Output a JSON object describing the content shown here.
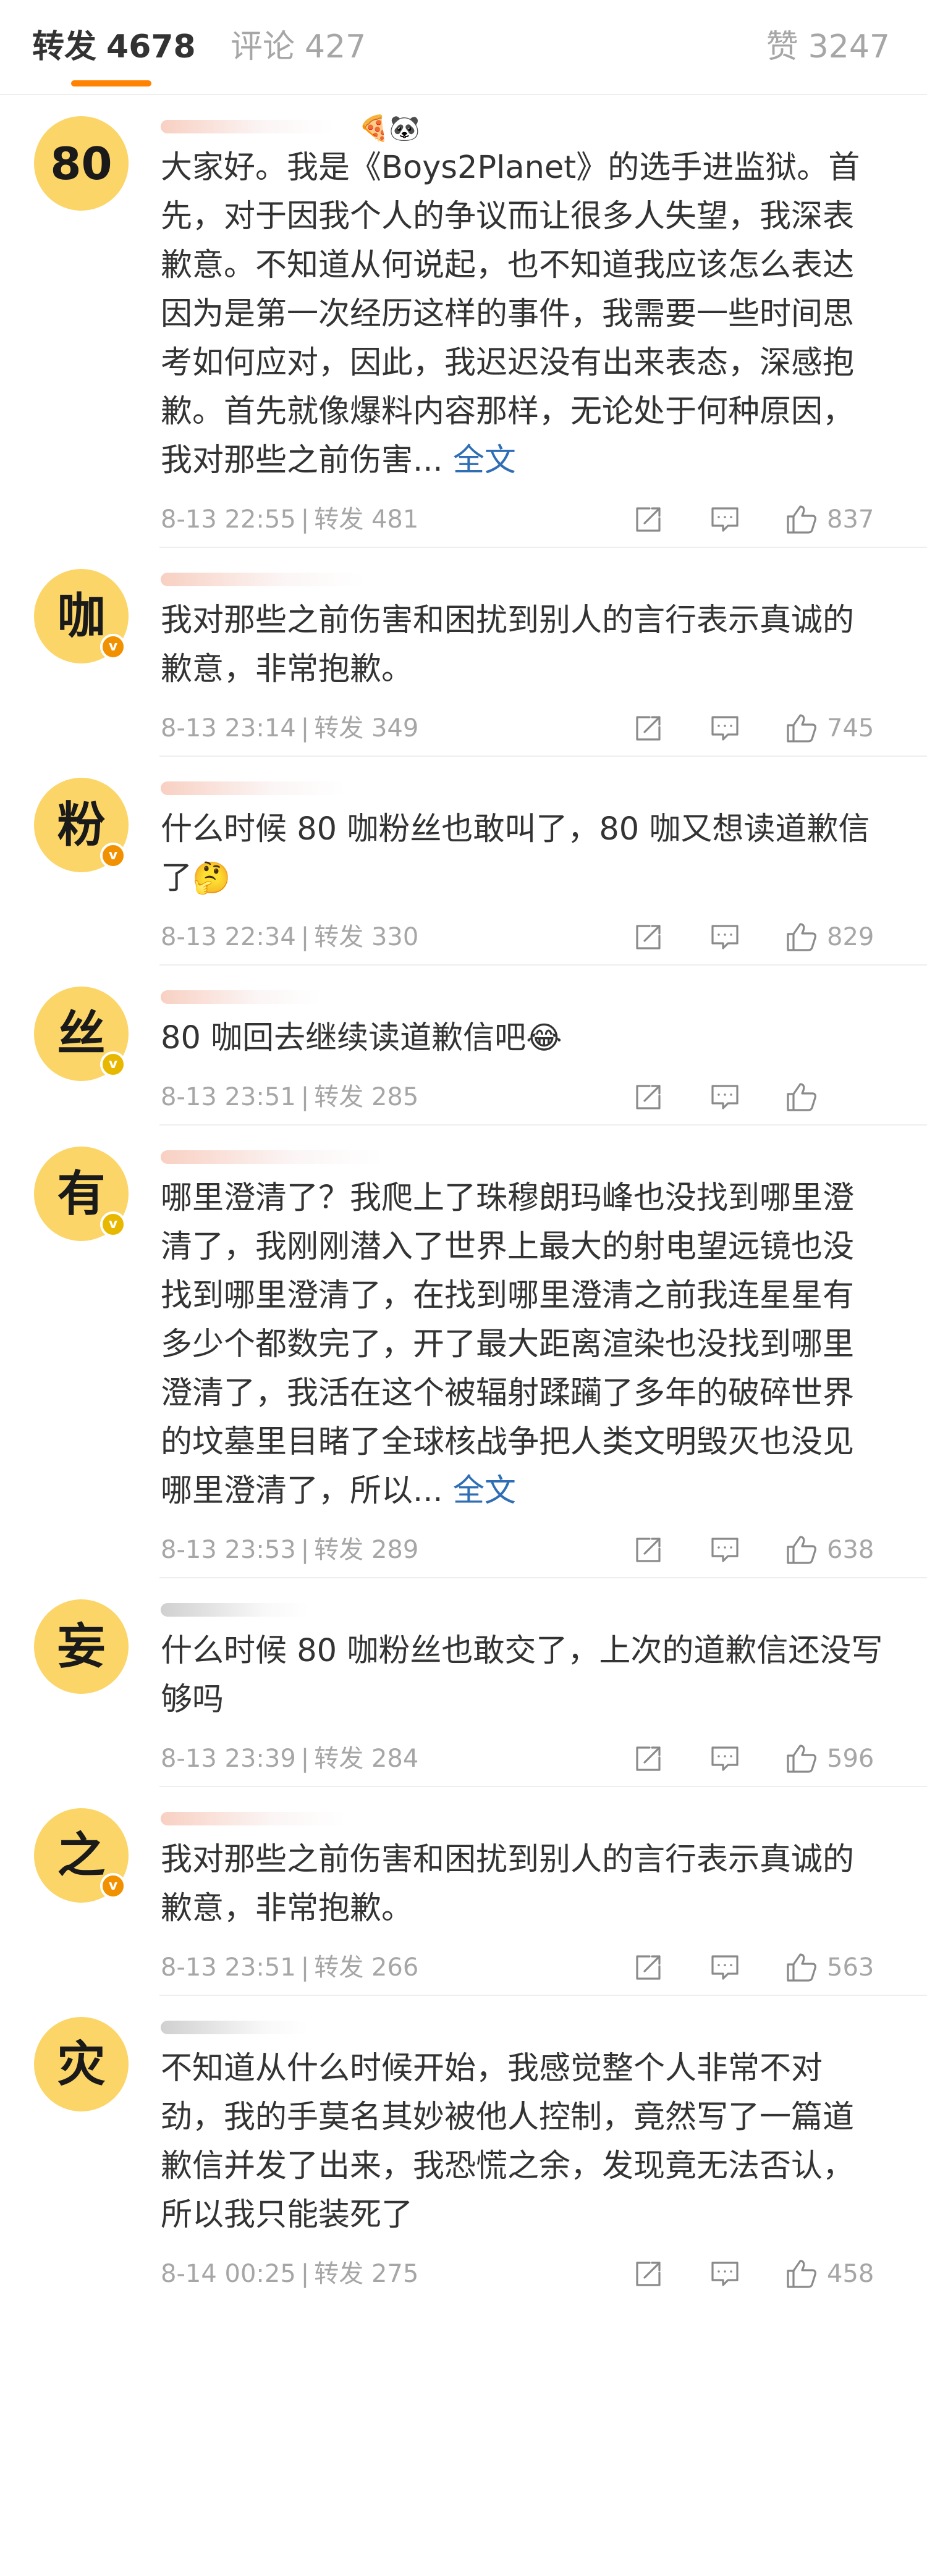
{
  "tabs": {
    "repost_label": "转发",
    "repost_count": "4678",
    "comment_label": "评论",
    "comment_count": "427",
    "like_label": "赞",
    "like_count": "3247"
  },
  "accent_color": "#ff8200",
  "avatar_color": "#fbd567",
  "link_color": "#2f6eb5",
  "posts": [
    {
      "avatar_char": "80",
      "badge": "",
      "username_icons": "🍕🐼",
      "text": "大家好。我是《Boys2Planet》的选手进监狱。首先，对于因我个人的争议而让很多人失望，我深表歉意。不知道从何说起，也不知道我应该怎么表达因为是第一次经历这样的事件，我需要一些时间思考如何应对，因此，我迟迟没有出来表态，深感抱歉。首先就像爆料内容那样，无论处于何种原因，我对那些之前伤害... ",
      "full_text": "全文",
      "emoji": "",
      "time": "8-13 22:55",
      "repost_label": "转发",
      "reposts": "481",
      "likes": "837"
    },
    {
      "avatar_char": "咖",
      "badge": "orange",
      "username_icons": "",
      "text": "我对那些之前伤害和困扰到别人的言行表示真诚的歉意，非常抱歉。",
      "full_text": "",
      "emoji": "",
      "time": "8-13 23:14",
      "repost_label": "转发",
      "reposts": "349",
      "likes": "745"
    },
    {
      "avatar_char": "粉",
      "badge": "orange",
      "username_icons": "",
      "text": "什么时候 80 咖粉丝也敢叫了，80 咖又想读道歉信了",
      "full_text": "",
      "emoji": "🤔",
      "time": "8-13 22:34",
      "repost_label": "转发",
      "reposts": "330",
      "likes": "829"
    },
    {
      "avatar_char": "丝",
      "badge": "yellow",
      "username_icons": "",
      "text": "80 咖回去继续读道歉信吧",
      "full_text": "",
      "emoji": "😂",
      "time": "8-13 23:51",
      "repost_label": "转发",
      "reposts": "285",
      "likes": ""
    },
    {
      "avatar_char": "有",
      "badge": "yellow",
      "username_icons": "",
      "text": "哪里澄清了？我爬上了珠穆朗玛峰也没找到哪里澄清了，我刚刚潜入了世界上最大的射电望远镜也没找到哪里澄清了，在找到哪里澄清之前我连星星有多少个都数完了，开了最大距离渲染也没找到哪里澄清了，我活在这个被辐射蹂躏了多年的破碎世界的坟墓里目睹了全球核战争把人类文明毁灭也没见哪里澄清了，所以... ",
      "full_text": "全文",
      "emoji": "",
      "time": "8-13 23:53",
      "repost_label": "转发",
      "reposts": "289",
      "likes": "638"
    },
    {
      "avatar_char": "妄",
      "badge": "",
      "username_icons": "",
      "text": "什么时候 80 咖粉丝也敢交了，上次的道歉信还没写够吗",
      "full_text": "",
      "emoji": "",
      "time": "8-13 23:39",
      "repost_label": "转发",
      "reposts": "284",
      "likes": "596"
    },
    {
      "avatar_char": "之",
      "badge": "orange",
      "username_icons": "",
      "text": "我对那些之前伤害和困扰到别人的言行表示真诚的歉意，非常抱歉。",
      "full_text": "",
      "emoji": "",
      "time": "8-13 23:51",
      "repost_label": "转发",
      "reposts": "266",
      "likes": "563"
    },
    {
      "avatar_char": "灾",
      "badge": "",
      "username_icons": "",
      "text": "不知道从什么时候开始，我感觉整个人非常不对劲，我的手莫名其妙被他人控制，竟然写了一篇道歉信并发了出来，我恐慌之余，发现竟无法否认，所以我只能装死了",
      "full_text": "",
      "emoji": "",
      "time": "8-14 00:25",
      "repost_label": "转发",
      "reposts": "275",
      "likes": "458"
    }
  ]
}
